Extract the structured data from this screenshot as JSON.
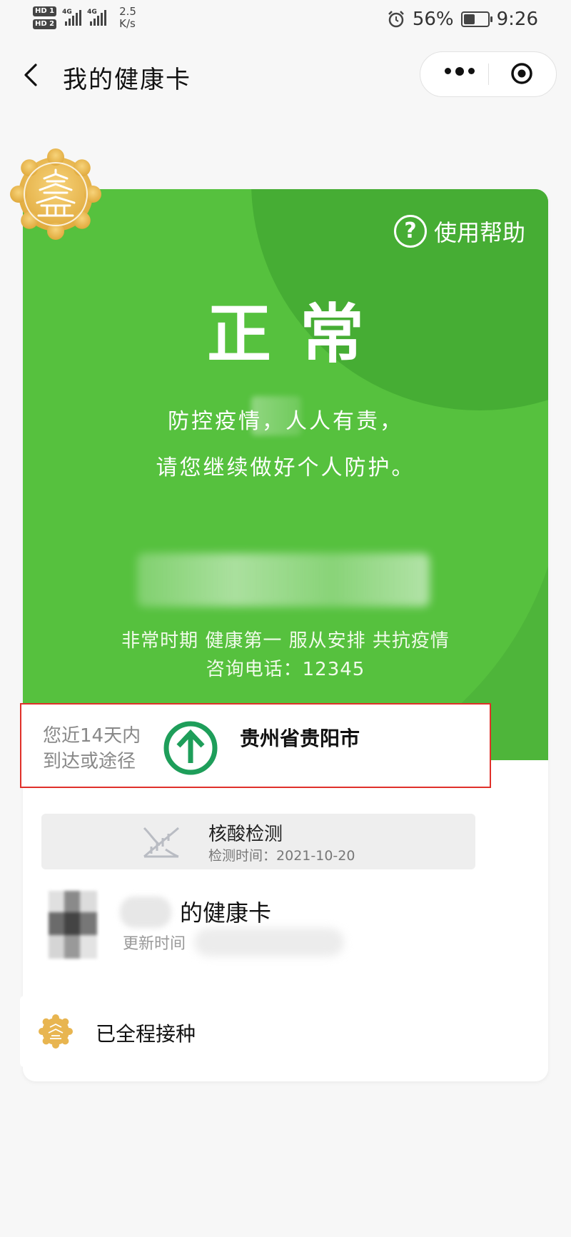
{
  "status_bar": {
    "hd1": "HD 1",
    "hd2": "HD 2",
    "net1": "4G",
    "net2": "4G",
    "speed_value": "2.5",
    "speed_unit": "K/s",
    "battery_percent": "56%",
    "battery_level": 0.56,
    "time": "9:26"
  },
  "nav": {
    "title": "我的健康卡"
  },
  "card": {
    "help_label": "使用帮助",
    "help_icon_glyph": "?",
    "status": "正常",
    "slogan_line1": "防控疫情，人人有责，",
    "slogan_line2": "请您继续做好个人防护。",
    "footer_line1": "非常时期 健康第一 服从安排 共抗疫情",
    "footer_line2": "咨询电话：12345",
    "theme_color": "#4eb53a"
  },
  "travel": {
    "label_line1": "您近14天内",
    "label_line2": "到达或途径",
    "city": "贵州省贵阳市",
    "icon_color": "#1e9e5a",
    "highlight_color": "#e0302a"
  },
  "nucleic": {
    "title": "核酸检测",
    "time_label": "检测时间：",
    "time_value": "2021-10-20"
  },
  "owner": {
    "card_suffix": "的健康卡",
    "update_label": "更新时间"
  },
  "vaccination": {
    "status": "已全程接种"
  }
}
